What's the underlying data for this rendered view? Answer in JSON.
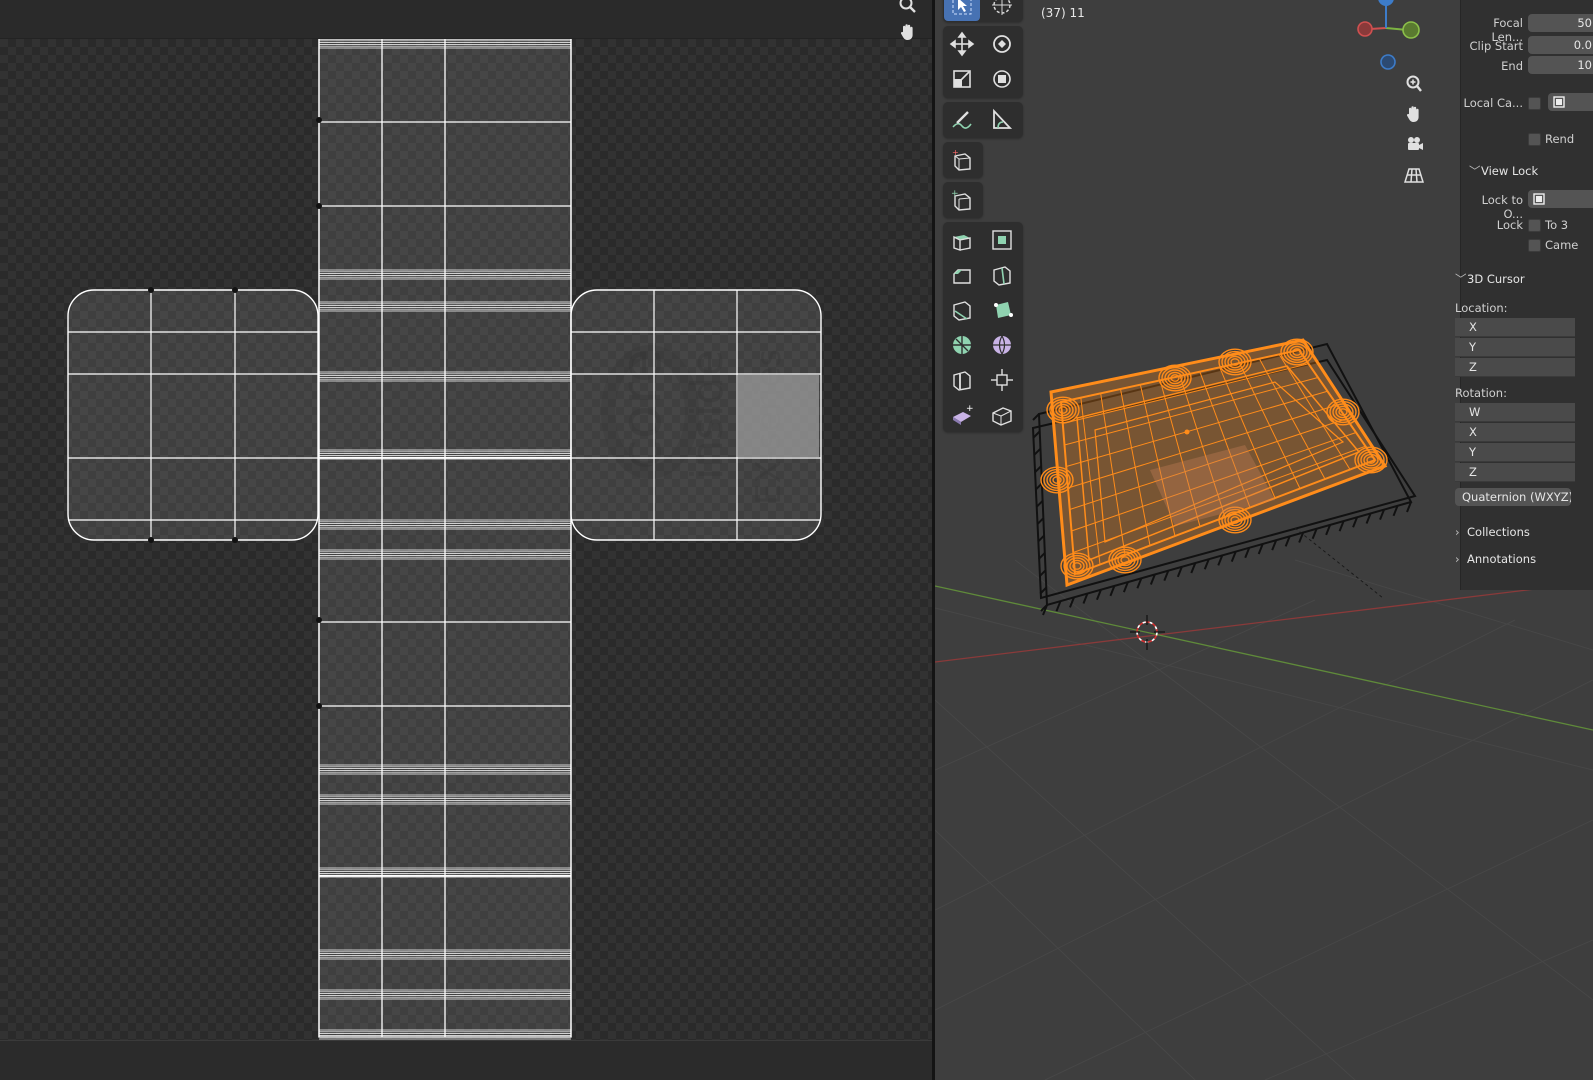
{
  "viewport": {
    "frame_info": "(37) 11"
  },
  "npanel": {
    "view_fields": [
      {
        "label": "Focal Len...",
        "value": "50"
      },
      {
        "label": "Clip Start",
        "value": "0.0"
      },
      {
        "label": "End",
        "value": "10"
      }
    ],
    "local_camera_label": "Local Ca...",
    "render_region_label": "Rend",
    "view_lock": {
      "title": "View Lock",
      "lock_to_object_label": "Lock to O...",
      "lock_label": "Lock",
      "to_3d_cursor_label": "To 3",
      "camera_to_view_label": "Came"
    },
    "cursor": {
      "title": "3D Cursor",
      "location_label": "Location:",
      "location_axes": [
        "X",
        "Y",
        "Z"
      ],
      "rotation_label": "Rotation:",
      "rotation_axes": [
        "W",
        "X",
        "Y",
        "Z"
      ],
      "rotation_mode": "Quaternion (WXYZ)"
    },
    "collapsed_sections": [
      "Collections",
      "Annotations"
    ]
  },
  "icons": {
    "uv_nav": [
      "zoom-icon",
      "pan-hand-icon"
    ],
    "viewport_nav": [
      "zoom-icon",
      "pan-hand-icon",
      "camera-icon",
      "perspective-grid-icon"
    ],
    "tools": [
      "select-box-icon",
      "cursor-icon",
      "move-icon",
      "rotate-icon",
      "scale-icon",
      "transform-icon",
      "annotate-icon",
      "measure-icon",
      "add-cube-icon",
      "add-primitive-icon",
      "extrude-icon",
      "inset-icon",
      "bevel-icon",
      "loop-cut-icon",
      "knife-icon",
      "poly-build-icon",
      "spin-icon",
      "smooth-icon",
      "edge-slide-icon",
      "shrink-fatten-icon",
      "shear-icon",
      "rip-region-icon"
    ]
  },
  "colors": {
    "active_tool": "#4772b3",
    "selection_orange": "#ff8c1a",
    "axis_x": "#d05050",
    "axis_y": "#7cb342",
    "axis_z": "#3d7cc9"
  }
}
